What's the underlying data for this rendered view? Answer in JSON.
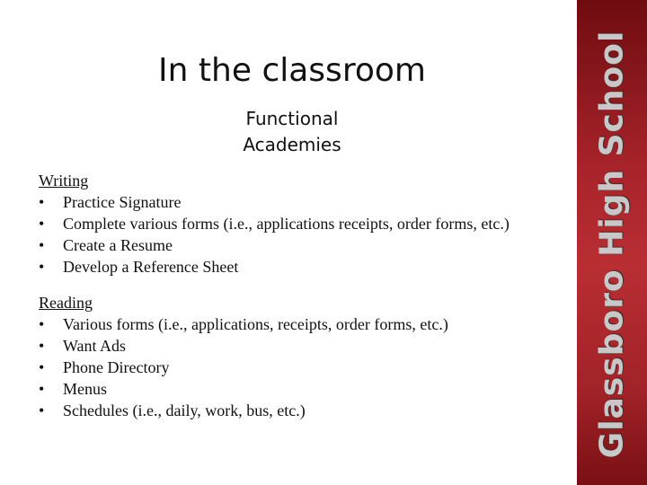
{
  "slide": {
    "title": "In the classroom",
    "subtitle_line1": "Functional",
    "subtitle_line2": "Academies",
    "sidebar_text": "Glassboro High School",
    "sidebar_color": "#a8242a"
  },
  "writing": {
    "heading": "Writing",
    "items": [
      "Practice Signature",
      "Complete various forms (i.e., applications receipts, order forms, etc.)",
      "Create a Resume",
      "Develop a Reference Sheet"
    ]
  },
  "reading": {
    "heading": "Reading",
    "items": [
      "Various forms (i.e., applications, receipts, order forms, etc.)",
      "Want Ads",
      "Phone Directory",
      "Menus",
      "Schedules (i.e., daily, work, bus, etc.)"
    ]
  },
  "bullet": "•"
}
